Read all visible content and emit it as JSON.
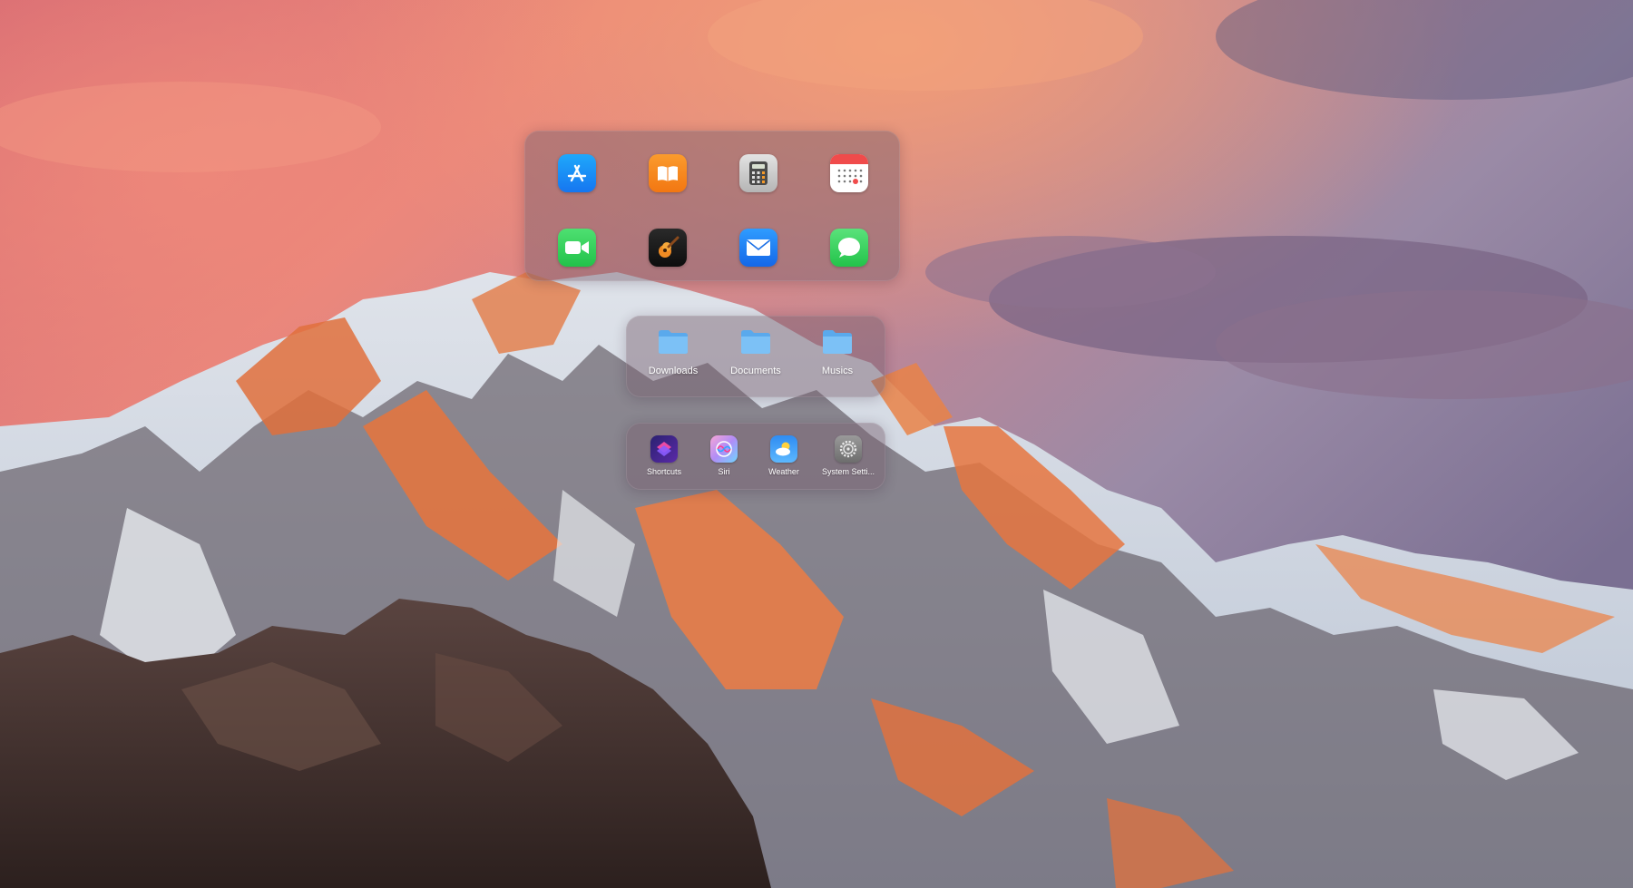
{
  "desktop": {
    "wallpaper": "mountain sunset",
    "colors": {
      "sky_pink": "#e37c7e",
      "sky_purple": "#8a7898",
      "peak_orange": "#e8703a",
      "snow": "#e6ebf2",
      "rock": "#3b2a28"
    }
  },
  "launcher": {
    "apps": [
      {
        "name": "App Store",
        "icon": "app-store-icon",
        "color": "#1b8cf5"
      },
      {
        "name": "Books",
        "icon": "books-icon",
        "color": "#f7891f"
      },
      {
        "name": "Calculator",
        "icon": "calculator-icon",
        "color": "#c9c9c9"
      },
      {
        "name": "Calendar",
        "icon": "calendar-icon",
        "color": "#ffffff"
      },
      {
        "name": "FaceTime",
        "icon": "facetime-icon",
        "color": "#2fd158"
      },
      {
        "name": "GarageBand",
        "icon": "garageband-icon",
        "color": "#1a1a1a"
      },
      {
        "name": "Mail",
        "icon": "mail-icon",
        "color": "#1f7cf0"
      },
      {
        "name": "Messages",
        "icon": "messages-icon",
        "color": "#31d057"
      }
    ]
  },
  "folders": {
    "items": [
      {
        "label": "Downloads",
        "icon": "folder-icon"
      },
      {
        "label": "Documents",
        "icon": "folder-icon"
      },
      {
        "label": "Musics",
        "icon": "folder-icon"
      }
    ]
  },
  "utilities": {
    "items": [
      {
        "label": "Shortcuts",
        "icon": "shortcuts-icon"
      },
      {
        "label": "Siri",
        "icon": "siri-icon"
      },
      {
        "label": "Weather",
        "icon": "weather-icon"
      },
      {
        "label": "System Setti...",
        "icon": "gear-icon"
      }
    ]
  }
}
